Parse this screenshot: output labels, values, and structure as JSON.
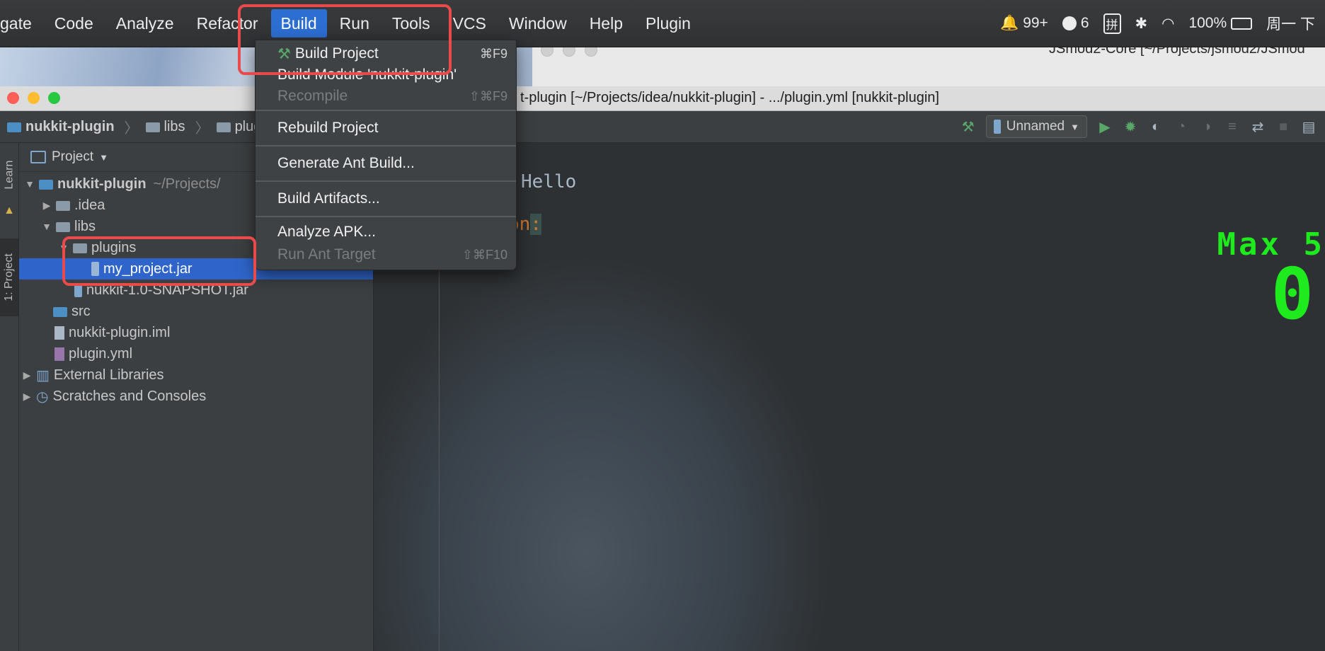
{
  "menubar": {
    "items": [
      "gate",
      "Code",
      "Analyze",
      "Refactor",
      "Build",
      "Run",
      "Tools",
      "VCS",
      "Window",
      "Help",
      "Plugin"
    ],
    "active": "Build",
    "status": {
      "qq_count": "99+",
      "message_count": "6",
      "input_method": "拼",
      "battery": "100%",
      "clock": "周一 下"
    }
  },
  "window2": {
    "title": "JSmod2-Core [~/Projects/jsmod2/JSmod"
  },
  "ide": {
    "title": "t-plugin [~/Projects/idea/nukkit-plugin] - .../plugin.yml [nukkit-plugin]",
    "breadcrumb": [
      "nukkit-plugin",
      "libs",
      "plugi"
    ],
    "run_config": "Unnamed",
    "left_tabs": {
      "learn": "Learn",
      "project": "1: Project"
    },
    "project_panel": {
      "header": "Project",
      "tree": [
        {
          "label": "nukkit-plugin",
          "extra": "~/Projects/",
          "bold": true
        },
        {
          "label": ".idea"
        },
        {
          "label": "libs"
        },
        {
          "label": "plugins"
        },
        {
          "label": "my_project.jar"
        },
        {
          "label": "nukkit-1.0-SNAPSHOT.jar"
        },
        {
          "label": "src"
        },
        {
          "label": "nukkit-plugin.iml"
        },
        {
          "label": "plugin.yml"
        },
        {
          "label": "External Libraries"
        },
        {
          "label": "Scratches and Consoles"
        }
      ]
    },
    "editor": {
      "line1": "Hello",
      "line2_keyword": "on",
      "line2_colon": ":",
      "overlay_title": "Max 5",
      "overlay_value": "0"
    }
  },
  "build_menu": {
    "build_project": {
      "label": "Build Project",
      "shortcut": "⌘F9"
    },
    "build_module": {
      "label": "Build Module 'nukkit-plugin'"
    },
    "recompile": {
      "label": "Recompile",
      "shortcut": "⇧⌘F9"
    },
    "rebuild_project": {
      "label": "Rebuild Project"
    },
    "generate_ant": {
      "label": "Generate Ant Build..."
    },
    "build_artifacts": {
      "label": "Build Artifacts..."
    },
    "analyze_apk": {
      "label": "Analyze APK..."
    },
    "run_ant_target": {
      "label": "Run Ant Target",
      "shortcut": "⇧⌘F10"
    }
  },
  "colors": {
    "accent": "#2d6ed2",
    "selection": "#2f65ca",
    "highlight": "#e94a4a",
    "game_green": "#1eea1e"
  }
}
